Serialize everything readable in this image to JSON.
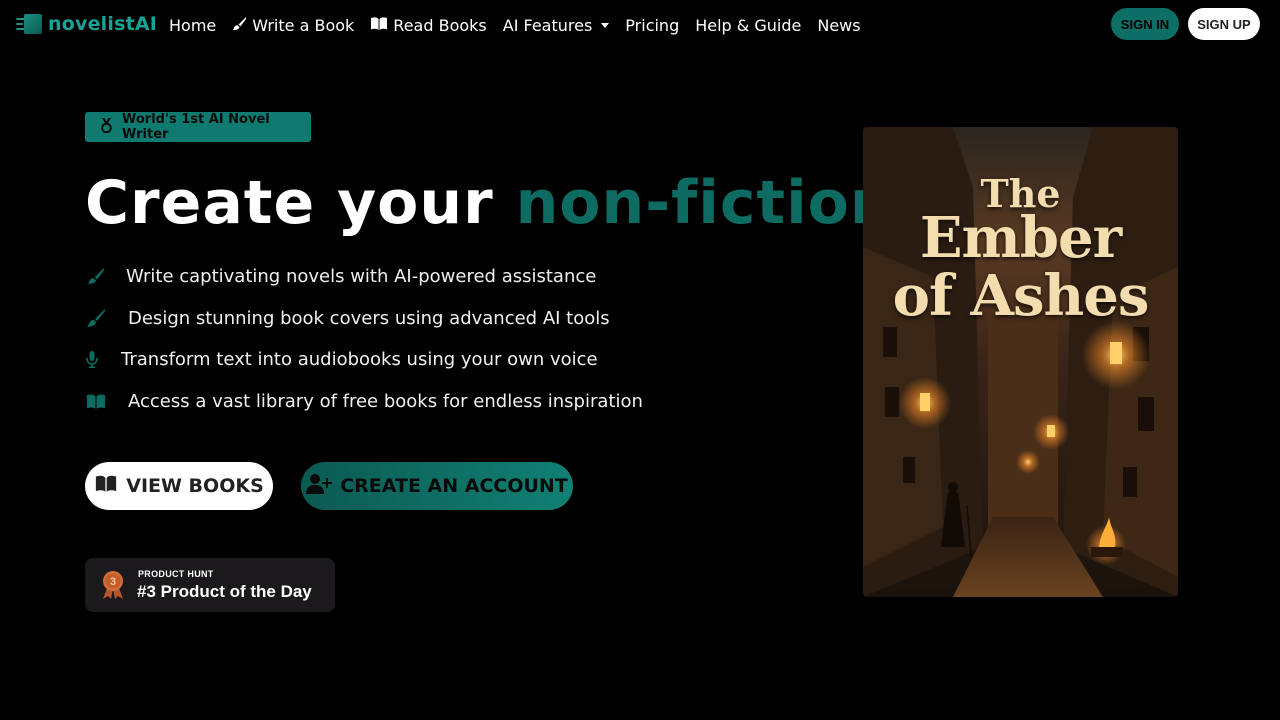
{
  "brand": {
    "name": "novelistAI",
    "accent_color": "#17a395"
  },
  "nav": {
    "items": [
      {
        "label": "Home",
        "icon": ""
      },
      {
        "label": "Write a Book",
        "icon": "brush-icon"
      },
      {
        "label": "Read Books",
        "icon": "open-book-icon"
      },
      {
        "label": "AI Features",
        "icon": "",
        "dropdown": true
      },
      {
        "label": "Pricing",
        "icon": ""
      },
      {
        "label": "Help & Guide",
        "icon": ""
      },
      {
        "label": "News",
        "icon": ""
      }
    ],
    "sign_in": "SIGN IN",
    "sign_up": "SIGN UP"
  },
  "hero": {
    "badge": "World's 1st AI Novel Writer",
    "headline_main": "Create your ",
    "headline_accent": "non-fiction",
    "features": [
      {
        "icon": "brush-icon",
        "text": "Write captivating novels with AI-powered assistance"
      },
      {
        "icon": "paintbrush-icon",
        "text": "Design stunning book covers using advanced AI tools"
      },
      {
        "icon": "microphone-icon",
        "text": "Transform text into audiobooks using your own voice"
      },
      {
        "icon": "open-book-icon",
        "text": "Access a vast library of free books for endless inspiration"
      }
    ],
    "view_books": "VIEW BOOKS",
    "create_account": "CREATE AN ACCOUNT"
  },
  "product_hunt": {
    "label": "PRODUCT HUNT",
    "rank_text": "#3 Product of the Day",
    "medal_number": "3"
  },
  "cover": {
    "title_line1": "The",
    "title_line2": "Ember",
    "title_line3": "of Ashes"
  },
  "colors": {
    "accent": "#0e6b62",
    "signin_bg": "#0c6e64",
    "background": "#000000"
  }
}
